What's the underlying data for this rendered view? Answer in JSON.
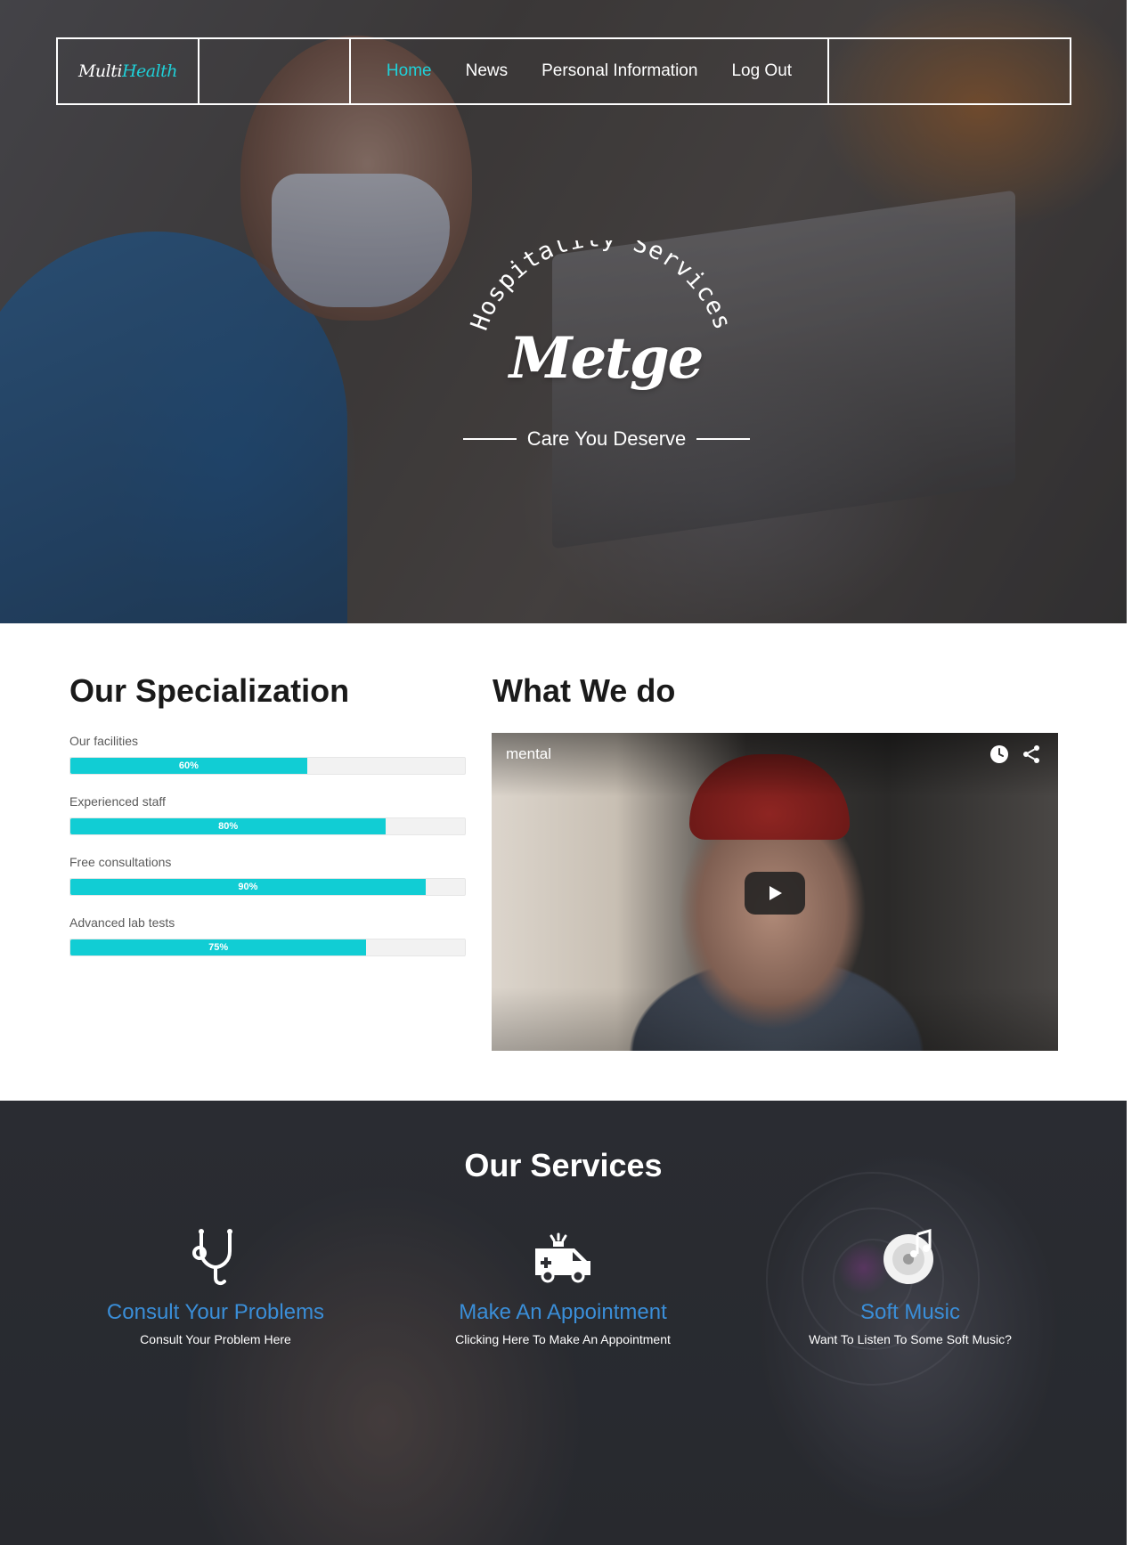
{
  "nav": {
    "logo_part1": "Multi",
    "logo_part2": "Health",
    "links": [
      "Home",
      "News",
      "Personal Information",
      "Log Out"
    ],
    "active": "Home"
  },
  "hero": {
    "arc_text": "Hospitality Services",
    "title": "Metge",
    "subtitle": "Care You Deserve"
  },
  "specialization": {
    "title": "Our Specialization",
    "skills": [
      {
        "label": "Our facilities",
        "value": 60,
        "display": "60%"
      },
      {
        "label": "Experienced staff",
        "value": 80,
        "display": "80%"
      },
      {
        "label": "Free consultations",
        "value": 90,
        "display": "90%"
      },
      {
        "label": "Advanced lab tests",
        "value": 75,
        "display": "75%"
      }
    ]
  },
  "what_we_do": {
    "title": "What We do",
    "video_title": "mental"
  },
  "services": {
    "title": "Our Services",
    "items": [
      {
        "title": "Consult Your Problems",
        "desc": "Consult Your Problem Here",
        "icon": "stethoscope-icon"
      },
      {
        "title": "Make An Appointment",
        "desc": "Clicking Here To Make An Appointment",
        "icon": "ambulance-icon"
      },
      {
        "title": "Soft Music",
        "desc": "Want To Listen To Some Soft Music?",
        "icon": "music-disc-icon"
      }
    ]
  },
  "colors": {
    "accent": "#1fd0d8",
    "bar_fill": "#11cdd4",
    "service_title": "#3a8ed8"
  }
}
